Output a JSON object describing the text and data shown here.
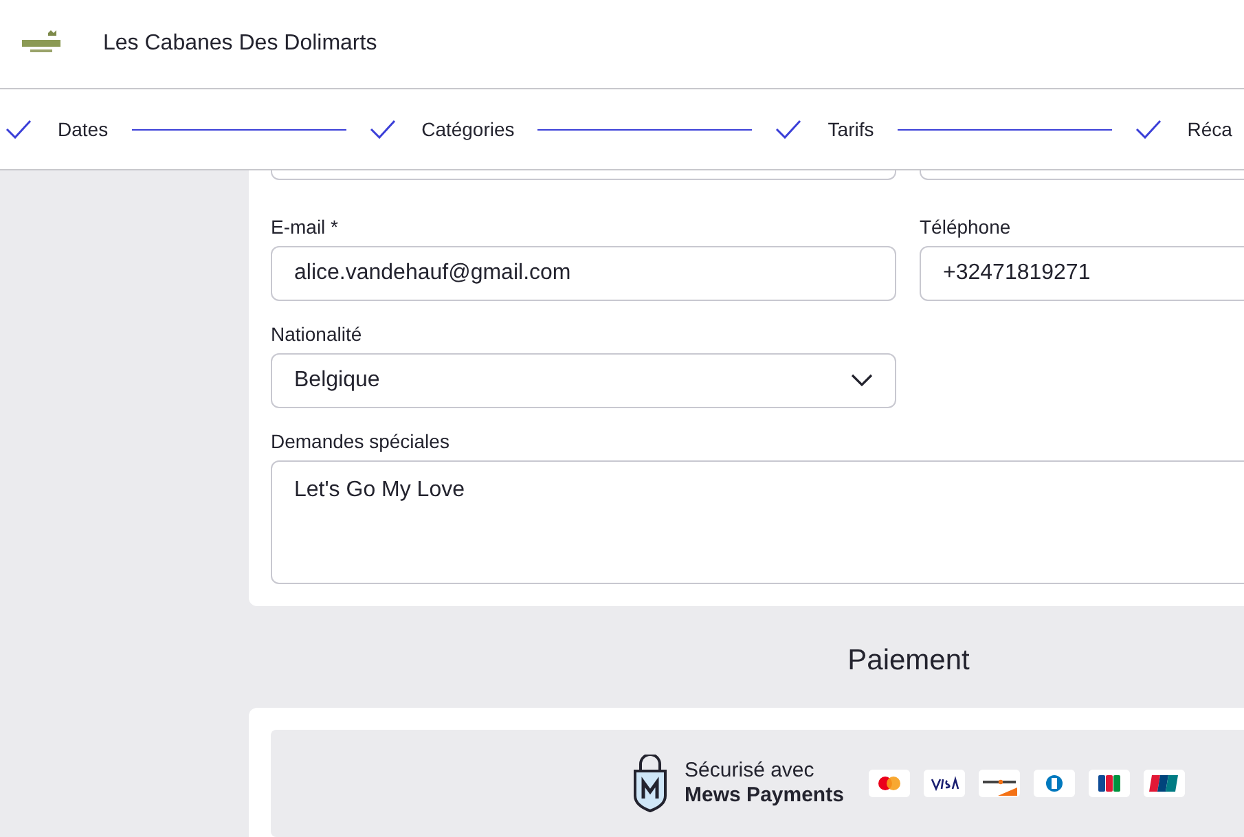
{
  "header": {
    "title": "Les Cabanes Des Dolimarts"
  },
  "steps": [
    {
      "label": "Dates",
      "done": true
    },
    {
      "label": "Catégories",
      "done": true
    },
    {
      "label": "Tarifs",
      "done": true
    },
    {
      "label": "Réca",
      "done": true
    }
  ],
  "form": {
    "fields": [
      {
        "label": "E-mail *",
        "value": "alice.vandehauf@gmail.com",
        "kind": "text"
      },
      {
        "label": "Téléphone",
        "value": "+32471819271",
        "kind": "text"
      },
      {
        "label": "Nationalité",
        "value": "Belgique",
        "kind": "select"
      }
    ],
    "special": {
      "label": "Demandes spéciales",
      "value": "Let's Go My Love"
    }
  },
  "payment": {
    "title": "Paiement",
    "secure_line": "Sécurisé avec",
    "provider": "Mews Payments"
  }
}
